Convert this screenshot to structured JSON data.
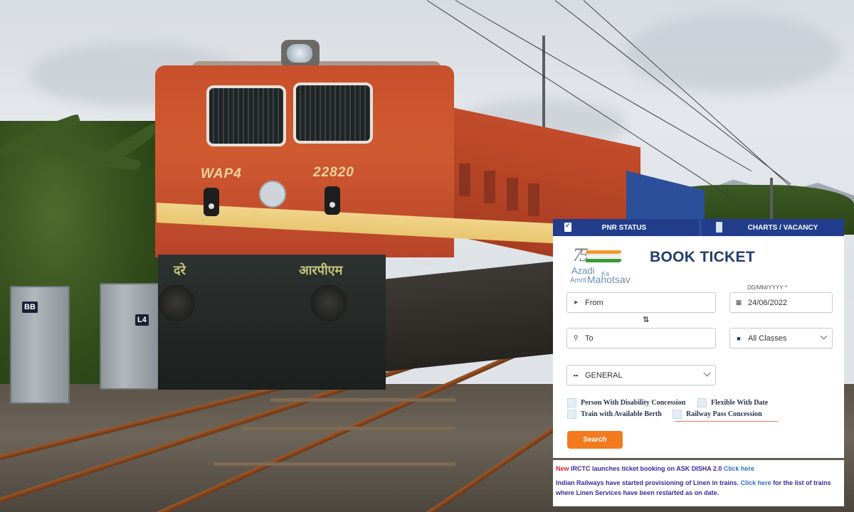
{
  "photo": {
    "locomotive_class": "WAP4",
    "locomotive_number": "22820",
    "hindi_left": "दरे",
    "hindi_center": "आरपीएम",
    "side_label": "CAB1",
    "cabinet_tags": [
      "BB",
      "L4"
    ]
  },
  "widget": {
    "tabs": [
      {
        "label": "PNR STATUS",
        "icon": "clipboard-check-icon"
      },
      {
        "label": "CHARTS / VACANCY",
        "icon": "document-icon"
      }
    ],
    "logo": {
      "number": "75",
      "line1": "Azadi",
      "ka": "Ka",
      "line2_a": "Amrit",
      "line2_b": "Mahotsav",
      "flag_colors": [
        "#f29a35",
        "#ffffff",
        "#3a9a3a"
      ]
    },
    "title": "BOOK TICKET",
    "date_label": "DD/MM/YYYY *",
    "from": {
      "placeholder": "From",
      "icon": "location-arrow-icon"
    },
    "to": {
      "placeholder": "To",
      "icon": "map-pin-icon"
    },
    "swap_glyph": "⇅",
    "date": {
      "value": "24/06/2022",
      "icon": "calendar-icon"
    },
    "class": {
      "value": "All Classes",
      "icon": "briefcase-icon"
    },
    "quota": {
      "value": "GENERAL",
      "icon": "grid-icon"
    },
    "checkboxes": [
      {
        "label": "Person With Disability Concession",
        "checked": false
      },
      {
        "label": "Flexible With Date",
        "checked": false
      },
      {
        "label": "Train with Available Berth",
        "checked": false
      },
      {
        "label": "Railway Pass Concession",
        "checked": false
      }
    ],
    "search_label": "Search",
    "news": {
      "badge": "New",
      "line1": "IRCTC launches ticket booking on ASK DISHA 2.0",
      "line1_link": "Click here",
      "line2_pre": "Indian Railways have started provisioning of Linen in trains.",
      "line2_link": "Click here",
      "line2_post": "for the list of trains where Linen Services have been restarted as on date."
    },
    "colors": {
      "tab_bg": "#213d8c",
      "title": "#213d6b",
      "search_button": "#f37a1f",
      "news_text": "#3a2a9a",
      "news_new": "#d8232a",
      "news_link": "#2f6fc2"
    }
  }
}
